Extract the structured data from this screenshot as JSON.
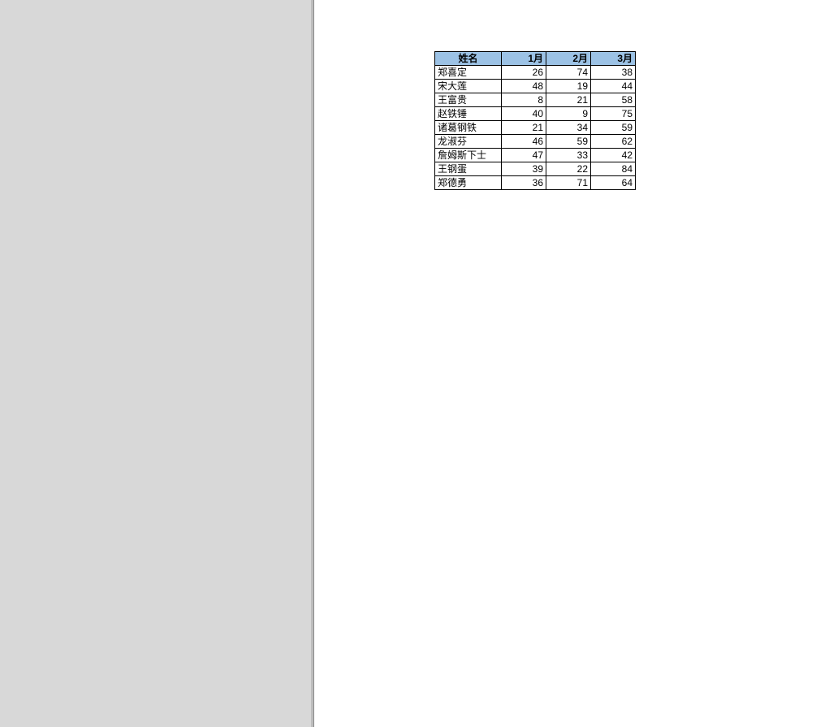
{
  "table": {
    "headers": [
      "姓名",
      "1月",
      "2月",
      "3月"
    ],
    "rows": [
      {
        "name": "郑喜定",
        "m1": 26,
        "m2": 74,
        "m3": 38
      },
      {
        "name": "宋大莲",
        "m1": 48,
        "m2": 19,
        "m3": 44
      },
      {
        "name": "王富贵",
        "m1": 8,
        "m2": 21,
        "m3": 58
      },
      {
        "name": "赵铁锤",
        "m1": 40,
        "m2": 9,
        "m3": 75
      },
      {
        "name": "诸葛钢铁",
        "m1": 21,
        "m2": 34,
        "m3": 59
      },
      {
        "name": "龙淑芬",
        "m1": 46,
        "m2": 59,
        "m3": 62
      },
      {
        "name": "詹姆斯下士",
        "m1": 47,
        "m2": 33,
        "m3": 42
      },
      {
        "name": "王钢蛋",
        "m1": 39,
        "m2": 22,
        "m3": 84
      },
      {
        "name": "郑德勇",
        "m1": 36,
        "m2": 71,
        "m3": 64
      }
    ]
  }
}
